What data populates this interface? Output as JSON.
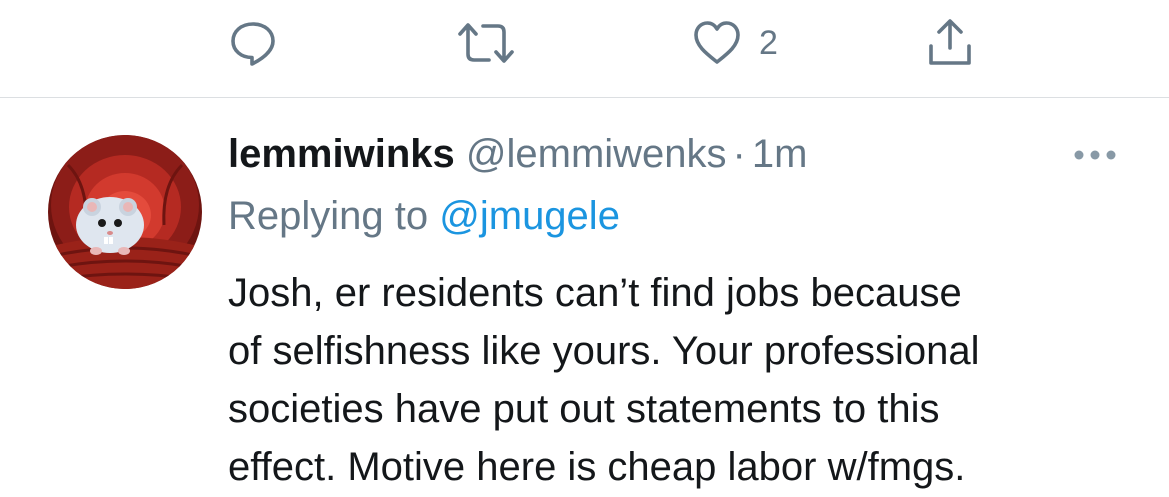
{
  "actions": {
    "reply_icon": "reply-icon",
    "retweet_icon": "retweet-icon",
    "like_icon": "heart-icon",
    "like_count": "2",
    "share_icon": "share-icon"
  },
  "tweet": {
    "display_name": "lemmiwinks",
    "handle": "@lemmiwenks",
    "separator": "·",
    "time": "1m",
    "replying_prefix": "Replying to",
    "replying_to": "@jmugele",
    "lines": [
      "Josh, er residents can’t find jobs because",
      "of selfishness like yours. Your professional",
      "societies have put out statements to this",
      "effect. Motive here is cheap labor w/fmgs."
    ]
  },
  "colors": {
    "text": "#14171a",
    "secondary": "#657786",
    "link": "#1b95e0",
    "divider": "#dcdfe2"
  }
}
